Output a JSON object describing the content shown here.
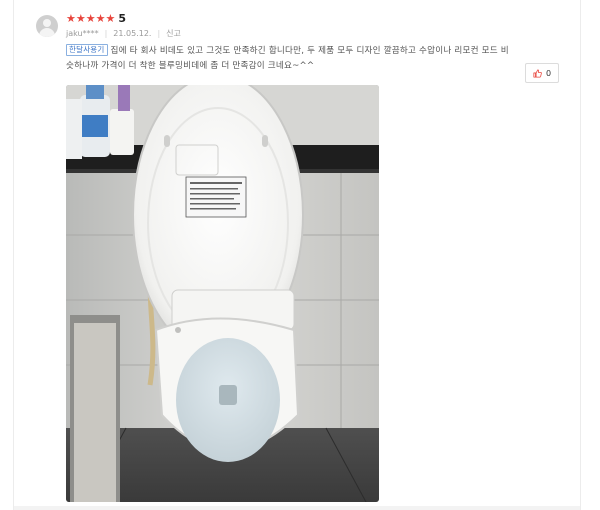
{
  "review": {
    "rating_stars": 5,
    "rating_value": "5",
    "user": "jaku****",
    "date": "21.05.12.",
    "report_label": "신고",
    "badge": "한달사용기",
    "text": "집에 타 회사 비데도 있고 그것도 만족하긴 합니다만, 두 제품 모두 디자인 깔끔하고 수압이나 리모컨 모드 비슷하나까 가격이 더 착한 블루밍비데에 좀 더 만족감이 크네요~^^",
    "like_count": "0"
  },
  "colors": {
    "star": "#e8453c",
    "badge_border": "#8ab0e0",
    "badge_text": "#3b74c7",
    "like_icon": "#e8453c"
  },
  "icons": {
    "avatar": "default-user-avatar",
    "like": "thumbs-up-icon"
  },
  "photo": {
    "description": "bidet toilet seat with lid open"
  }
}
